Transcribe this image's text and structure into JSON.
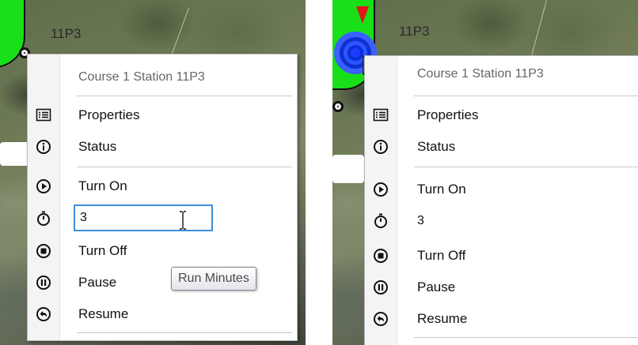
{
  "left_panel": {
    "station_label": "11P3",
    "menu": {
      "title": "Course 1 Station 11P3",
      "items": {
        "properties": "Properties",
        "status": "Status",
        "turn_on": "Turn On",
        "turn_off": "Turn Off",
        "pause": "Pause",
        "resume": "Resume"
      },
      "minutes_input": {
        "value": "3"
      }
    },
    "tooltip": "Run Minutes"
  },
  "right_panel": {
    "station_label": "11P3",
    "menu": {
      "title": "Course 1 Station 11P3",
      "items": {
        "properties": "Properties",
        "status": "Status",
        "turn_on": "Turn On",
        "turn_off": "Turn Off",
        "pause": "Pause",
        "resume": "Resume"
      },
      "minutes_input": {
        "value": "3"
      }
    }
  },
  "colors": {
    "menu_bg": "#ffffff",
    "input_focus_border": "#3c8fd8",
    "station_zone": "#18e018",
    "selection_marker": "#1c3cff"
  },
  "icons": {
    "properties": "list-icon",
    "status": "info-icon",
    "turn_on": "play-icon",
    "minutes": "stopwatch-icon",
    "turn_off": "stop-icon",
    "pause": "pause-icon",
    "resume": "undo-icon"
  }
}
